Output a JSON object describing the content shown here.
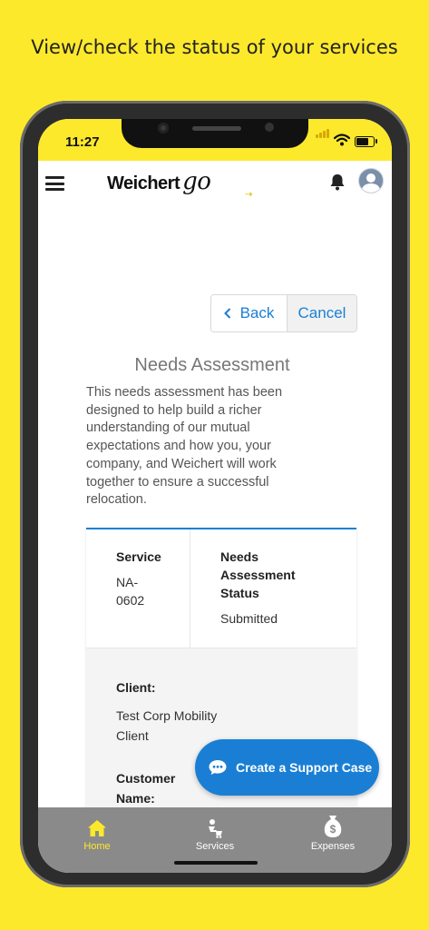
{
  "promo": {
    "headline": "View/check the status of your services"
  },
  "status_bar": {
    "time": "11:27"
  },
  "app_bar": {
    "logo_text": "Weichert",
    "logo_script": "go"
  },
  "nav": {
    "back_label": "Back",
    "cancel_label": "Cancel"
  },
  "page": {
    "title": "Needs Assessment",
    "intro": "This needs assessment has been designed to help build a richer understanding of our mutual expectations and how you, your company, and Weichert will work together to ensure a successful relocation."
  },
  "card": {
    "service_label": "Service",
    "service_value_line1": "NA-",
    "service_value_line2": "0602",
    "status_label_line1": "Needs",
    "status_label_line2": "Assessment",
    "status_label_line3": "Status",
    "status_value": "Submitted",
    "client_label": "Client:",
    "client_value_line1": "Test Corp Mobility",
    "client_value_line2": "Client",
    "customer_label_line1": "Customer",
    "customer_label_line2": "Name:"
  },
  "fab": {
    "label": "Create a Support Case"
  },
  "tabs": [
    {
      "label": "Home",
      "icon": "home-icon",
      "active": true
    },
    {
      "label": "Services",
      "icon": "services-icon",
      "active": false
    },
    {
      "label": "Expenses",
      "icon": "expenses-icon",
      "active": false
    }
  ],
  "colors": {
    "brand_yellow": "#fde92c",
    "accent_blue": "#1a7fd4",
    "tabbar_gray": "#8a8a8a"
  }
}
